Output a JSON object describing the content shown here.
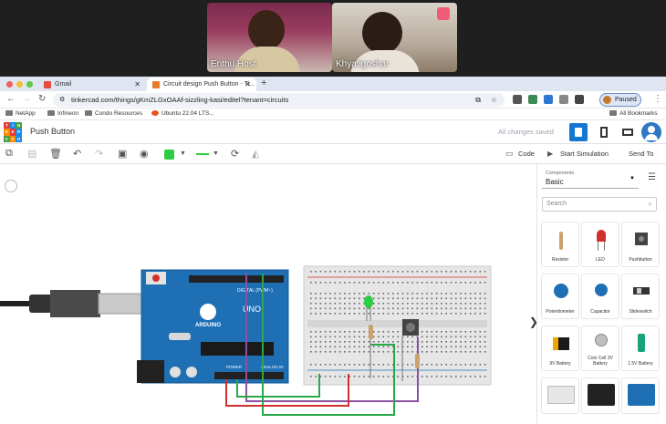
{
  "meeting": {
    "participants": [
      {
        "name": "Enthu Host"
      },
      {
        "name": "Khyatigoshar"
      }
    ]
  },
  "browser": {
    "tabs": [
      {
        "label": "Gmail"
      },
      {
        "label": "Circuit design Push Button - Ti..."
      }
    ],
    "url": "tinkercad.com/things/gKmZLGxOAAf-sizzling-kasi/editel?tenant=circuits",
    "profile_label": "Paused",
    "bookmarks": [
      "NetApp",
      "Infineon",
      "Condo Resources",
      "Ubuntu 22.04 LTS..."
    ],
    "all_bookmarks": "All Bookmarks"
  },
  "app": {
    "logo_letters": [
      "TIN",
      "KER",
      "CAD"
    ],
    "project_title": "Push Button",
    "save_status": "All changes saved",
    "code_label": "Code",
    "start_sim_label": "Start Simulation",
    "send_to_label": "Send To"
  },
  "panel": {
    "components_caption": "Components",
    "components_value": "Basic",
    "search_placeholder": "Search",
    "items": [
      {
        "label": "Resistor",
        "icon": "resistor-icon"
      },
      {
        "label": "LED",
        "icon": "led-icon"
      },
      {
        "label": "Pushbutton",
        "icon": "pushbutton-icon"
      },
      {
        "label": "Potentiometer",
        "icon": "potentiometer-icon"
      },
      {
        "label": "Capacitor",
        "icon": "capacitor-icon"
      },
      {
        "label": "Slideswitch",
        "icon": "slideswitch-icon"
      },
      {
        "label": "9V Battery",
        "icon": "battery-9v-icon"
      },
      {
        "label": "Coin Cell 3V Battery",
        "icon": "coin-cell-icon"
      },
      {
        "label": "1.5V Battery",
        "icon": "battery-15v-icon"
      }
    ]
  },
  "board": {
    "brand": "ARDUINO",
    "model": "UNO",
    "digital_label": "DIGITAL (PWM~)",
    "power_label": "POWER",
    "analog_label": "ANALOG IN"
  },
  "colors": {
    "accent": "#1477d1",
    "arduino_blue": "#1f6fb5",
    "wire_red": "#d0312d",
    "wire_green": "#2aa84a",
    "wire_purple": "#8e4fa3"
  }
}
